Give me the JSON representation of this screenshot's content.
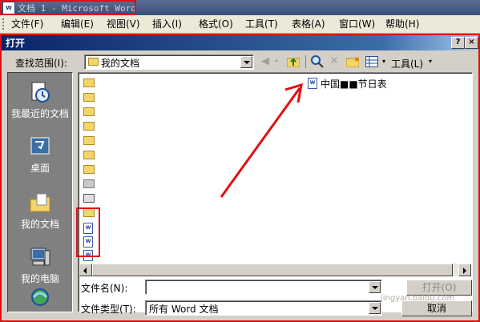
{
  "window": {
    "title": "文档 1 - Microsoft Word",
    "icon": "word-doc-icon"
  },
  "menu": {
    "items": [
      "文件(F)",
      "编辑(E)",
      "视图(V)",
      "插入(I)",
      "格式(O)",
      "工具(T)",
      "表格(A)",
      "窗口(W)",
      "帮助(H)"
    ]
  },
  "dialog": {
    "title": "打开",
    "help_label": "?",
    "close_label": "×",
    "look_in_label": "查找范围(I):",
    "look_in_value": "我的文档",
    "tools_label": "工具(L)",
    "places": [
      {
        "name": "我最近的文档",
        "icon": "recent-docs-icon"
      },
      {
        "name": "桌面",
        "icon": "desktop-icon"
      },
      {
        "name": "我的文档",
        "icon": "my-documents-icon"
      },
      {
        "name": "我的电脑",
        "icon": "my-computer-icon"
      }
    ],
    "files": {
      "named_item": "中国■■节日表"
    },
    "filename_label": "文件名(N):",
    "filename_value": "",
    "filetype_label": "文件类型(T):",
    "filetype_value": "所有 Word 文档",
    "open_label": "打开(O)",
    "cancel_label": "取消",
    "watermark": "jingyan.baidu.com"
  },
  "colors": {
    "annotation_red": "#e01010",
    "titlebar_blue": "#0a246a"
  }
}
